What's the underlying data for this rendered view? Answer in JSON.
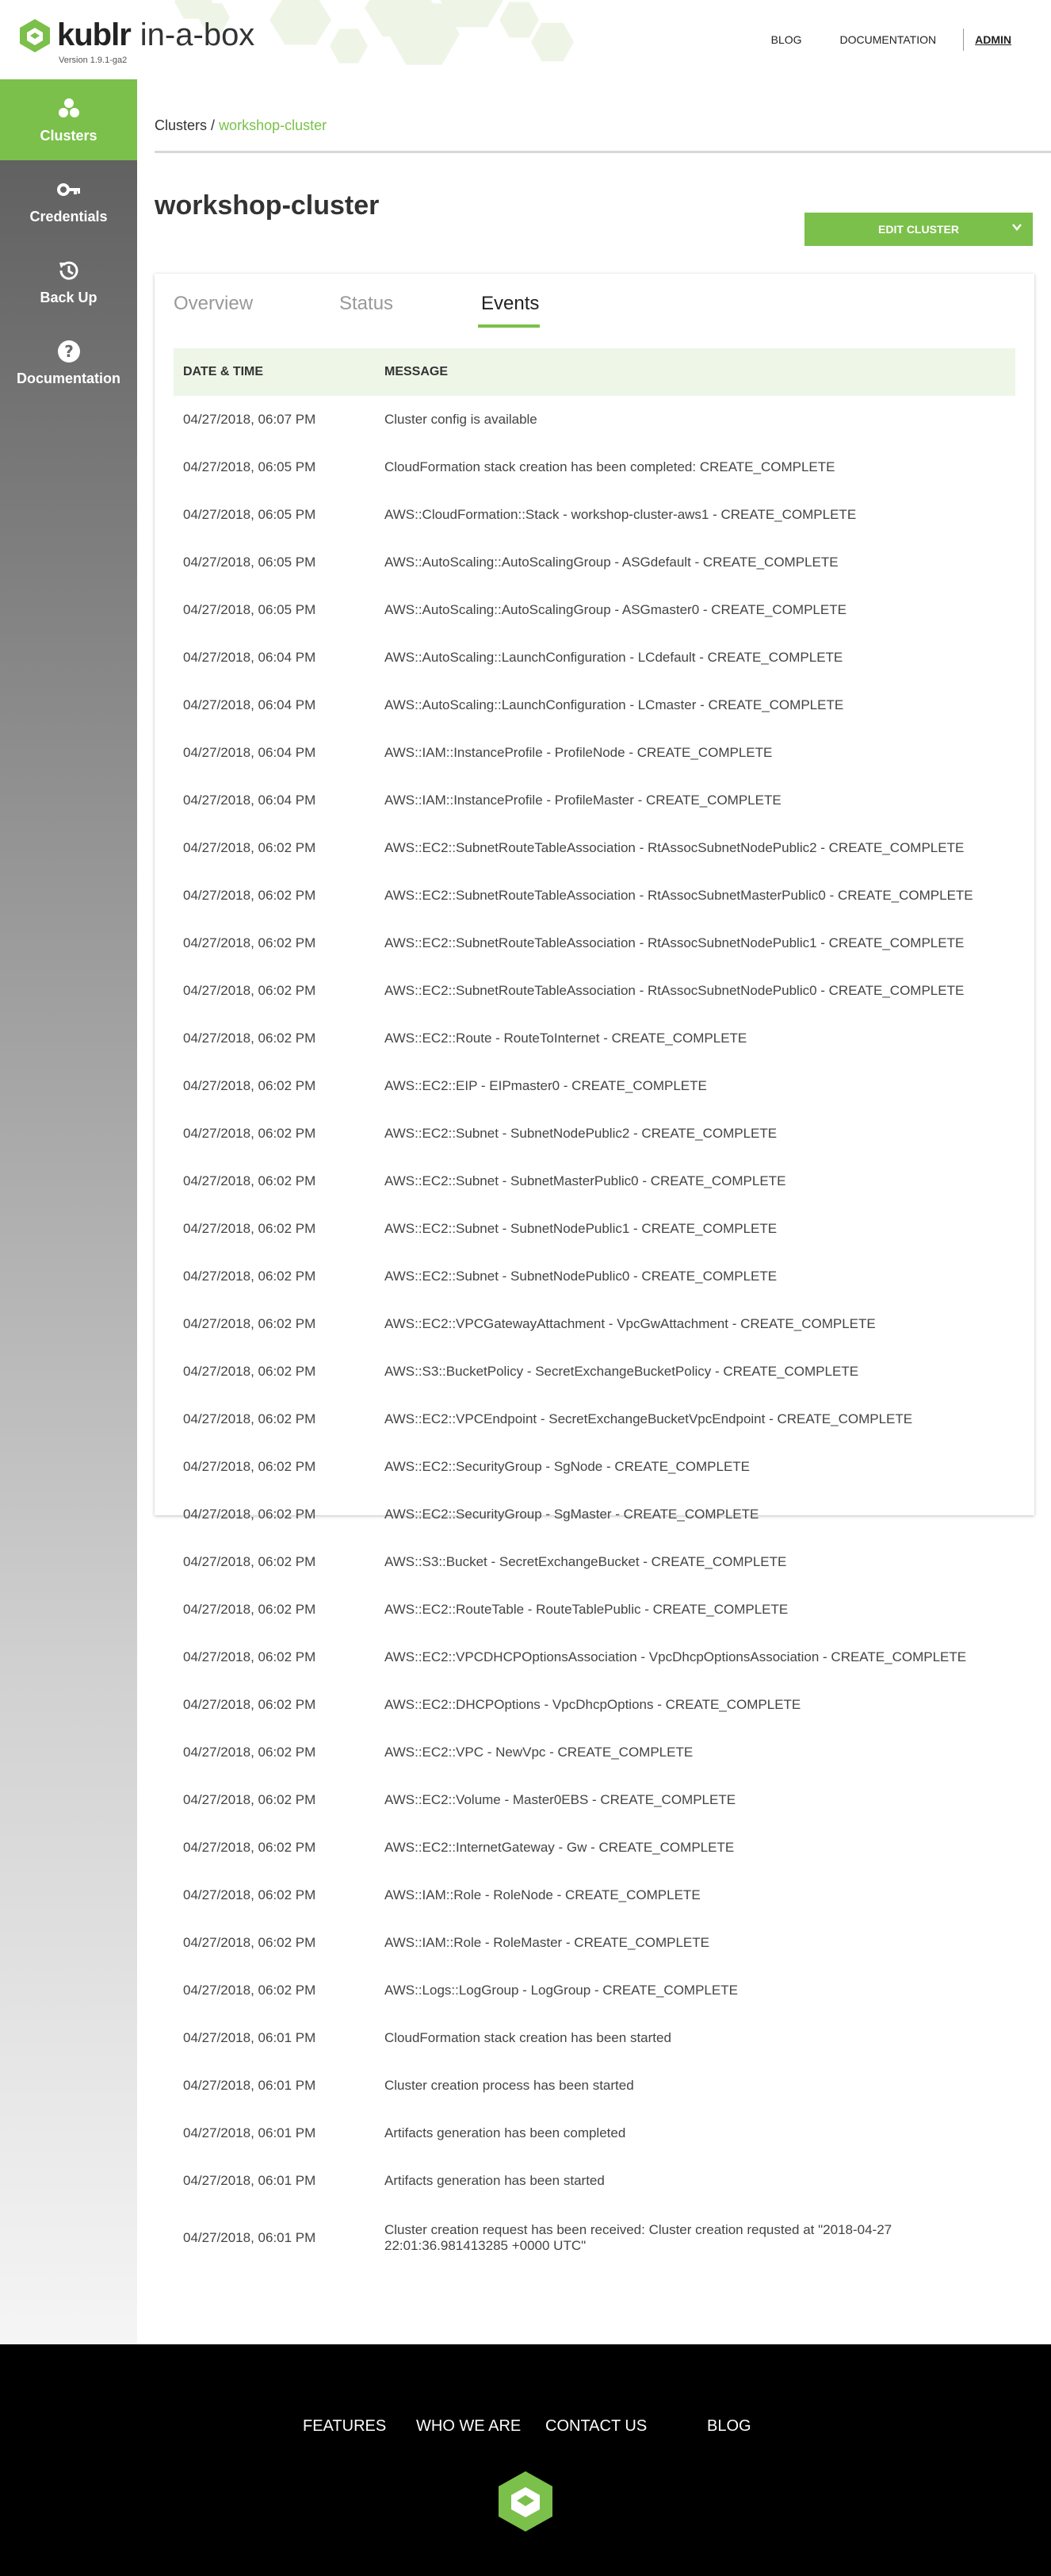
{
  "brand": {
    "name": "kublr",
    "product": "in-a-box",
    "version": "Version 1.9.1-ga2",
    "accent": "#7bc04a"
  },
  "topnav": {
    "items": [
      "BLOG",
      "DOCUMENTATION"
    ],
    "user": "admin"
  },
  "sidebar": {
    "items": [
      {
        "label": "Clusters",
        "icon": "clusters-icon"
      },
      {
        "label": "Credentials",
        "icon": "key-icon"
      },
      {
        "label": "Back Up",
        "icon": "history-icon"
      },
      {
        "label": "Documentation",
        "icon": "help-icon"
      }
    ]
  },
  "breadcrumb": {
    "root": "Clusters",
    "separator": "/",
    "current": "workshop-cluster"
  },
  "page": {
    "title": "workshop-cluster",
    "edit_button": "EDIT CLUSTER"
  },
  "tabs": [
    "Overview",
    "Status",
    "Events"
  ],
  "events": {
    "columns": [
      "DATE & TIME",
      "MESSAGE"
    ],
    "rows": [
      [
        "04/27/2018, 06:07 PM",
        "Cluster config is available"
      ],
      [
        "04/27/2018, 06:05 PM",
        "CloudFormation stack creation has been completed: CREATE_COMPLETE"
      ],
      [
        "04/27/2018, 06:05 PM",
        "AWS::CloudFormation::Stack - workshop-cluster-aws1 - CREATE_COMPLETE"
      ],
      [
        "04/27/2018, 06:05 PM",
        "AWS::AutoScaling::AutoScalingGroup - ASGdefault - CREATE_COMPLETE"
      ],
      [
        "04/27/2018, 06:05 PM",
        "AWS::AutoScaling::AutoScalingGroup - ASGmaster0 - CREATE_COMPLETE"
      ],
      [
        "04/27/2018, 06:04 PM",
        "AWS::AutoScaling::LaunchConfiguration - LCdefault - CREATE_COMPLETE"
      ],
      [
        "04/27/2018, 06:04 PM",
        "AWS::AutoScaling::LaunchConfiguration - LCmaster - CREATE_COMPLETE"
      ],
      [
        "04/27/2018, 06:04 PM",
        "AWS::IAM::InstanceProfile - ProfileNode - CREATE_COMPLETE"
      ],
      [
        "04/27/2018, 06:04 PM",
        "AWS::IAM::InstanceProfile - ProfileMaster - CREATE_COMPLETE"
      ],
      [
        "04/27/2018, 06:02 PM",
        "AWS::EC2::SubnetRouteTableAssociation - RtAssocSubnetNodePublic2 - CREATE_COMPLETE"
      ],
      [
        "04/27/2018, 06:02 PM",
        "AWS::EC2::SubnetRouteTableAssociation - RtAssocSubnetMasterPublic0 - CREATE_COMPLETE"
      ],
      [
        "04/27/2018, 06:02 PM",
        "AWS::EC2::SubnetRouteTableAssociation - RtAssocSubnetNodePublic1 - CREATE_COMPLETE"
      ],
      [
        "04/27/2018, 06:02 PM",
        "AWS::EC2::SubnetRouteTableAssociation - RtAssocSubnetNodePublic0 - CREATE_COMPLETE"
      ],
      [
        "04/27/2018, 06:02 PM",
        "AWS::EC2::Route - RouteToInternet - CREATE_COMPLETE"
      ],
      [
        "04/27/2018, 06:02 PM",
        "AWS::EC2::EIP - EIPmaster0 - CREATE_COMPLETE"
      ],
      [
        "04/27/2018, 06:02 PM",
        "AWS::EC2::Subnet - SubnetNodePublic2 - CREATE_COMPLETE"
      ],
      [
        "04/27/2018, 06:02 PM",
        "AWS::EC2::Subnet - SubnetMasterPublic0 - CREATE_COMPLETE"
      ],
      [
        "04/27/2018, 06:02 PM",
        "AWS::EC2::Subnet - SubnetNodePublic1 - CREATE_COMPLETE"
      ],
      [
        "04/27/2018, 06:02 PM",
        "AWS::EC2::Subnet - SubnetNodePublic0 - CREATE_COMPLETE"
      ],
      [
        "04/27/2018, 06:02 PM",
        "AWS::EC2::VPCGatewayAttachment - VpcGwAttachment - CREATE_COMPLETE"
      ],
      [
        "04/27/2018, 06:02 PM",
        "AWS::S3::BucketPolicy - SecretExchangeBucketPolicy - CREATE_COMPLETE"
      ],
      [
        "04/27/2018, 06:02 PM",
        "AWS::EC2::VPCEndpoint - SecretExchangeBucketVpcEndpoint - CREATE_COMPLETE"
      ],
      [
        "04/27/2018, 06:02 PM",
        "AWS::EC2::SecurityGroup - SgNode - CREATE_COMPLETE"
      ],
      [
        "04/27/2018, 06:02 PM",
        "AWS::EC2::SecurityGroup - SgMaster - CREATE_COMPLETE"
      ],
      [
        "04/27/2018, 06:02 PM",
        "AWS::S3::Bucket - SecretExchangeBucket - CREATE_COMPLETE"
      ],
      [
        "04/27/2018, 06:02 PM",
        "AWS::EC2::RouteTable - RouteTablePublic - CREATE_COMPLETE"
      ],
      [
        "04/27/2018, 06:02 PM",
        "AWS::EC2::VPCDHCPOptionsAssociation - VpcDhcpOptionsAssociation - CREATE_COMPLETE"
      ],
      [
        "04/27/2018, 06:02 PM",
        "AWS::EC2::DHCPOptions - VpcDhcpOptions - CREATE_COMPLETE"
      ],
      [
        "04/27/2018, 06:02 PM",
        "AWS::EC2::VPC - NewVpc - CREATE_COMPLETE"
      ],
      [
        "04/27/2018, 06:02 PM",
        "AWS::EC2::Volume - Master0EBS - CREATE_COMPLETE"
      ],
      [
        "04/27/2018, 06:02 PM",
        "AWS::EC2::InternetGateway - Gw - CREATE_COMPLETE"
      ],
      [
        "04/27/2018, 06:02 PM",
        "AWS::IAM::Role - RoleNode - CREATE_COMPLETE"
      ],
      [
        "04/27/2018, 06:02 PM",
        "AWS::IAM::Role - RoleMaster - CREATE_COMPLETE"
      ],
      [
        "04/27/2018, 06:02 PM",
        "AWS::Logs::LogGroup - LogGroup - CREATE_COMPLETE"
      ],
      [
        "04/27/2018, 06:01 PM",
        "CloudFormation stack creation has been started"
      ],
      [
        "04/27/2018, 06:01 PM",
        "Cluster creation process has been started"
      ],
      [
        "04/27/2018, 06:01 PM",
        "Artifacts generation has been completed"
      ],
      [
        "04/27/2018, 06:01 PM",
        "Artifacts generation has been started"
      ],
      [
        "04/27/2018, 06:01 PM",
        "Cluster creation request has been received: Cluster creation requsted at \"2018-04-27 22:01:36.981413285 +0000 UTC\""
      ]
    ]
  },
  "footer": {
    "links": [
      "FEATURES",
      "WHO WE ARE",
      "CONTACT US",
      "BLOG"
    ]
  }
}
